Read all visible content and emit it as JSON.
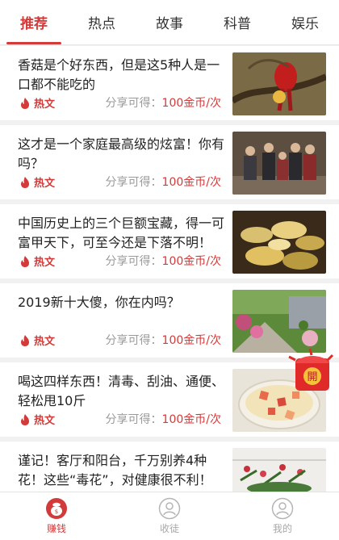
{
  "tabs": [
    "推荐",
    "热点",
    "故事",
    "科普",
    "娱乐"
  ],
  "hot_label": "热文",
  "share_prefix": "分享可得：",
  "articles": [
    {
      "title": "香菇是个好东西，但是这5种人是一口都不能吃的",
      "reward": "100金币/次",
      "image": "red-bird-on-branch"
    },
    {
      "title": "这才是一个家庭最高级的炫富！你有吗？",
      "reward": "100金币/次",
      "image": "family-portrait"
    },
    {
      "title": "中国历史上的三个巨额宝藏，得一可富甲天下，可至今还是下落不明！",
      "reward": "100金币/次",
      "image": "gold-ingots"
    },
    {
      "title": "2019新十大傻，你在内吗？",
      "reward": "100金币/次",
      "image": "garden"
    },
    {
      "title": "喝这四样东西！清毒、刮油、通便、轻松甩10斤",
      "reward": "100金币/次",
      "image": "fruit-dessert-bowl"
    },
    {
      "title": "谨记！客厅和阳台，千万别养4种花！这些“毒花”，对健康很不利！",
      "reward": "",
      "image": "flower-plant"
    }
  ],
  "red_packet_label": "開",
  "nav": [
    {
      "label": "赚钱",
      "icon": "coin-bag-icon",
      "active": true
    },
    {
      "label": "收徒",
      "icon": "person-icon",
      "active": false
    },
    {
      "label": "我的",
      "icon": "profile-icon",
      "active": false
    }
  ],
  "colors": {
    "accent": "#d33a3a",
    "muted": "#9a9a9a"
  }
}
